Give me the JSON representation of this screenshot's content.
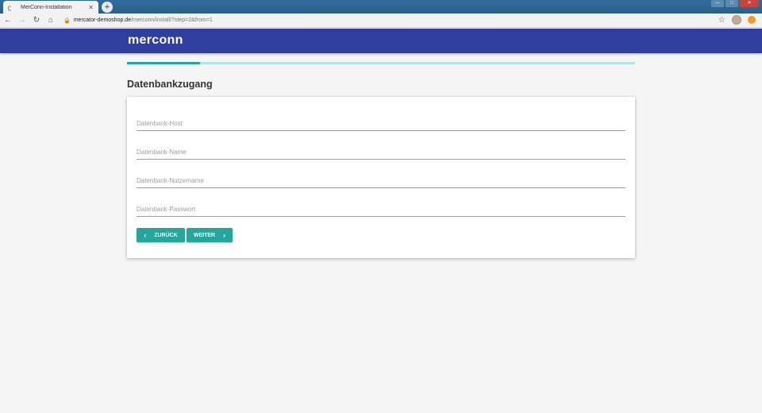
{
  "browser": {
    "tab_title": "MerConn-Installation",
    "tab_close": "✕",
    "newtab": "+",
    "url_host": "mercator-demoshop.de",
    "url_path": "/merconn/install/?step=2&from=1",
    "nav": {
      "back": "←",
      "forward": "→",
      "reload": "↻",
      "home": "⌂"
    }
  },
  "app": {
    "logo": "merconn"
  },
  "progress": {
    "fraction": 0.143,
    "fill_color": "#26a69a",
    "track_color": "#b2e5e0"
  },
  "page": {
    "title": "Datenbankzugang"
  },
  "form": {
    "fields": [
      {
        "placeholder": "Datenbank-Host",
        "value": ""
      },
      {
        "placeholder": "Datenbank-Name",
        "value": ""
      },
      {
        "placeholder": "Datenbank-Nutzername",
        "value": ""
      },
      {
        "placeholder": "Datenbank-Passwort",
        "value": ""
      }
    ],
    "back_label": "ZURÜCK",
    "next_label": "WEITER"
  },
  "colors": {
    "appbar": "#303f9f",
    "accent": "#26a69a"
  }
}
